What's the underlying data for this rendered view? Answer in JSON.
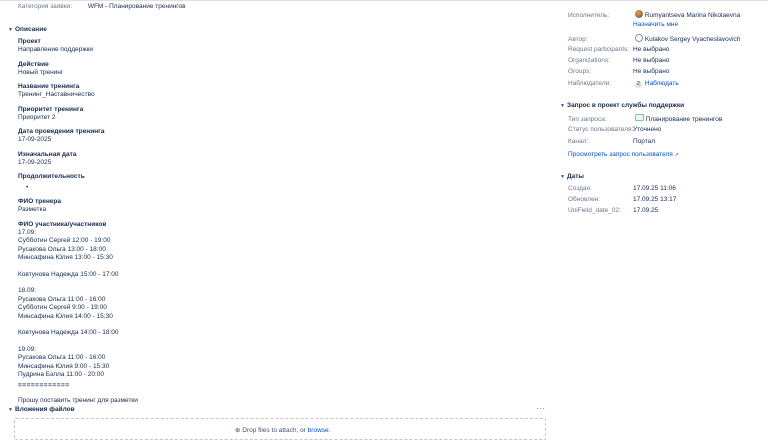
{
  "request_category": {
    "label": "Категория заявки:",
    "value": "WFM - Планирование тренингов"
  },
  "description": {
    "header": "Описание",
    "fields": [
      {
        "title": "Проект",
        "value": "Направление поддержки"
      },
      {
        "title": "Действие",
        "value": "Новый тренинг"
      },
      {
        "title": "Название тренинга",
        "value": "Тренинг_Наставничество"
      },
      {
        "title": "Приоритет тренинга",
        "value": "Приоритет 2"
      },
      {
        "title": "Дата проведения тренинга",
        "value": "17-09-2025"
      },
      {
        "title": "Изначальная дата",
        "value": "17-09-2025"
      },
      {
        "title": "Продолжительность",
        "value": ""
      },
      {
        "title": "ФИО тренера",
        "value": "Разметка"
      }
    ],
    "participants_title": "ФИО участника/участников",
    "participants": [
      {
        "date": "17.09:",
        "lines": [
          "Субботин Сергей 12:00 - 19:00",
          "Русакова Ольга 13:00 - 18:00",
          "Минсафина Юлия 13:00 - 15:30"
        ],
        "extra": "Ковтунова Надежда 15:00 - 17:00"
      },
      {
        "date": "18.09:",
        "lines": [
          "Русакова Ольга 11:00 - 16:00",
          "Субботин Сергей 9:00 - 19:00",
          "Минсафина Юлия 14:00 - 15:30"
        ],
        "extra": "Ковтунова Надежда 14:00 - 18:00"
      },
      {
        "date": "19.09:",
        "lines": [
          "Русакова Ольга 11:00 - 16:00",
          "Минсафина Юлия 9:00 - 15:30",
          "Пудрина Бэлла 11:00 - 20:00"
        ],
        "extra": ""
      }
    ],
    "separator": "============",
    "note": "Прошу поставить тренинг для разметки"
  },
  "attachments": {
    "header": "Вложения файлов",
    "more": "···",
    "drop_text": "Drop files to attach, or",
    "browse_label": "browse."
  },
  "people": {
    "assignee_label": "Исполнитель:",
    "assignee_name": "Rumyantseva Marina Nikolaevna",
    "assign_to_me": "Назначить мне",
    "author_label": "Автор:",
    "author_name": "Kulakov Sergey Vyacheslavovich",
    "rows": [
      {
        "label": "Request participants:",
        "value": "Не выбрано"
      },
      {
        "label": "Organizations:",
        "value": "Не выбрано"
      },
      {
        "label": "Groups:",
        "value": "Не выбрано"
      }
    ],
    "watchers_label": "Наблюдатели:",
    "watchers_count": "2",
    "watch_link": "Наблюдать"
  },
  "service_desk": {
    "header": "Запрос в проект службы поддержки",
    "request_type_label": "Тип запроса:",
    "request_type_value": "Планирование тренингов",
    "user_status_label": "Статус пользователя:",
    "user_status_value": "Уточнено",
    "channel_label": "Канал:",
    "channel_value": "Портал",
    "view_link": "Просмотреть запрос пользователя"
  },
  "dates": {
    "header": "Даты",
    "rows": [
      {
        "label": "Создан:",
        "value": "17.09.25 11:06"
      },
      {
        "label": "Обновлен:",
        "value": "17.09.25 13:17"
      },
      {
        "label": "UniField_date_02:",
        "value": "17.09.25"
      }
    ]
  },
  "icons": {
    "collapse": "chevron-down-icon",
    "avatar": "user-avatar",
    "request_type": "request-type-icon",
    "external_link": "external-link-icon"
  }
}
